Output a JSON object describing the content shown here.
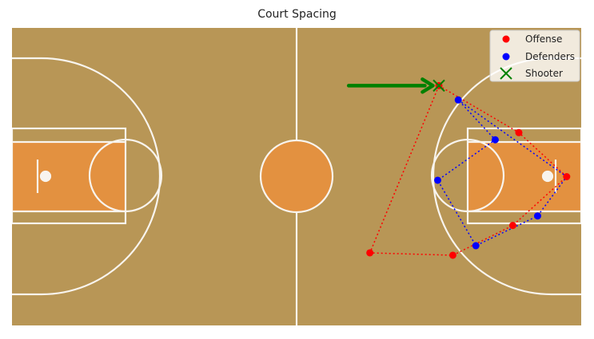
{
  "chart_data": {
    "type": "scatter",
    "title": "Court Spacing",
    "xlabel": "",
    "ylabel": "",
    "xlim": [
      0,
      94
    ],
    "ylim": [
      0,
      50
    ],
    "grid": false,
    "axes_visible": false,
    "legend_position": "top-right",
    "background": "basketball-court",
    "colors": {
      "court_wood": "#B89656",
      "paint": "#E8913E",
      "court_lines": "#FFFFFF",
      "offense": "#FF0000",
      "defenders": "#0000FF",
      "shooter": "#008000",
      "arrow": "#008000"
    },
    "series": [
      {
        "name": "Offense",
        "marker": "circle",
        "color": "#FF0000",
        "points": [
          [
            70.5,
            40.3
          ],
          [
            83.7,
            32.4
          ],
          [
            91.6,
            25.0
          ],
          [
            82.7,
            16.8
          ],
          [
            72.8,
            11.8
          ],
          [
            59.1,
            12.2
          ]
        ]
      },
      {
        "name": "Defenders",
        "marker": "circle",
        "color": "#0000FF",
        "points": [
          [
            73.7,
            37.9
          ],
          [
            79.8,
            31.2
          ],
          [
            70.3,
            24.4
          ],
          [
            86.8,
            18.4
          ],
          [
            76.6,
            13.4
          ]
        ]
      },
      {
        "name": "Shooter",
        "marker": "x",
        "color": "#008000",
        "points": [
          [
            70.5,
            40.3
          ]
        ]
      }
    ],
    "lines": [
      {
        "name": "offense-spacing",
        "style": "dotted",
        "color": "#FF0000",
        "close": true,
        "points": [
          [
            70.5,
            40.3
          ],
          [
            83.7,
            32.4
          ],
          [
            91.6,
            25.0
          ],
          [
            82.7,
            16.8
          ],
          [
            72.8,
            11.8
          ],
          [
            59.1,
            12.2
          ]
        ]
      },
      {
        "name": "defense-spacing",
        "style": "dotted",
        "color": "#0000FF",
        "close": true,
        "points": [
          [
            73.7,
            37.9
          ],
          [
            91.6,
            25.0
          ],
          [
            86.8,
            18.4
          ],
          [
            76.6,
            13.4
          ],
          [
            70.3,
            24.4
          ],
          [
            79.8,
            31.2
          ]
        ]
      }
    ],
    "arrow": {
      "from": [
        55.6,
        40.3
      ],
      "to": [
        69.5,
        40.3
      ],
      "color": "#008000"
    }
  }
}
